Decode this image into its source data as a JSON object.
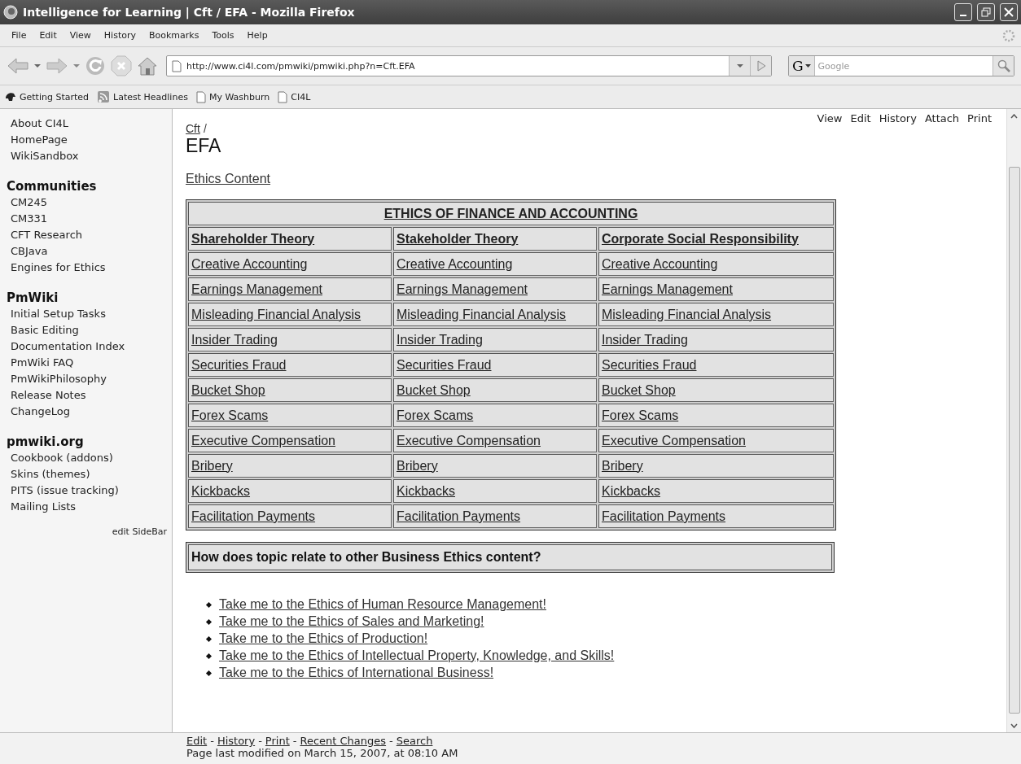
{
  "window": {
    "title": "Intelligence for Learning | Cft / EFA - Mozilla Firefox"
  },
  "menu": [
    "File",
    "Edit",
    "View",
    "History",
    "Bookmarks",
    "Tools",
    "Help"
  ],
  "address": {
    "value": "http://www.ci4l.com/pmwiki/pmwiki.php?n=Cft.EFA"
  },
  "search": {
    "placeholder": "Google",
    "engine": "G"
  },
  "bookmarks": [
    {
      "kind": "site",
      "label": "Getting Started"
    },
    {
      "kind": "feed",
      "label": "Latest Headlines"
    },
    {
      "kind": "page",
      "label": "My Washburn"
    },
    {
      "kind": "page",
      "label": "CI4L"
    }
  ],
  "sidebar": {
    "groups": [
      {
        "items": [
          "About CI4L",
          "HomePage",
          "WikiSandbox"
        ]
      },
      {
        "heading": "Communities",
        "items": [
          "CM245",
          "CM331",
          "CFT Research",
          "CBJava",
          "Engines for Ethics"
        ]
      },
      {
        "heading": "PmWiki",
        "items": [
          "Initial Setup Tasks",
          "Basic Editing",
          "Documentation Index",
          "PmWiki FAQ",
          "PmWikiPhilosophy",
          "Release Notes",
          "ChangeLog"
        ]
      },
      {
        "heading": "pmwiki.org",
        "items": [
          "Cookbook (addons)",
          "Skins (themes)",
          "PITS (issue tracking)",
          "Mailing Lists"
        ]
      }
    ],
    "edit_link": "edit SideBar"
  },
  "page_actions": [
    "View",
    "Edit",
    "History",
    "Attach",
    "Print"
  ],
  "breadcrumb": {
    "link": "Cft",
    "separator": "/"
  },
  "page_title": "EFA",
  "intro_link": "Ethics Content",
  "table": {
    "title": "ETHICS OF FINANCE AND ACCOUNTING",
    "columns": [
      "Shareholder Theory",
      "Stakeholder Theory",
      "Corporate Social Responsibility"
    ],
    "rows": [
      [
        "Creative Accounting",
        "Creative Accounting",
        "Creative Accounting"
      ],
      [
        "Earnings Management",
        "Earnings Management",
        "Earnings Management"
      ],
      [
        "Misleading Financial Analysis",
        "Misleading Financial Analysis",
        "Misleading Financial Analysis"
      ],
      [
        "Insider Trading",
        "Insider Trading",
        "Insider Trading"
      ],
      [
        "Securities Fraud",
        "Securities Fraud",
        "Securities Fraud"
      ],
      [
        "Bucket Shop",
        "Bucket Shop",
        "Bucket Shop"
      ],
      [
        "Forex Scams",
        "Forex Scams",
        "Forex Scams"
      ],
      [
        "Executive Compensation",
        "Executive Compensation",
        "Executive Compensation"
      ],
      [
        "Bribery",
        "Bribery",
        "Bribery"
      ],
      [
        "Kickbacks",
        "Kickbacks",
        "Kickbacks"
      ],
      [
        "Facilitation Payments",
        "Facilitation Payments",
        "Facilitation Payments"
      ]
    ]
  },
  "related": {
    "heading": "How does topic relate to other Business Ethics content?",
    "links": [
      "Take me to the Ethics of Human Resource Management!",
      "Take me to the Ethics of Sales and Marketing!",
      "Take me to the Ethics of Production!",
      "Take me to the Ethics of Intellectual Property, Knowledge, and Skills!",
      "Take me to the Ethics of International Business!"
    ]
  },
  "footer": {
    "links": [
      "Edit",
      "History",
      "Print",
      "Recent Changes",
      "Search"
    ],
    "separator": "-",
    "modified": "Page last modified on March 15, 2007, at 08:10 AM"
  }
}
